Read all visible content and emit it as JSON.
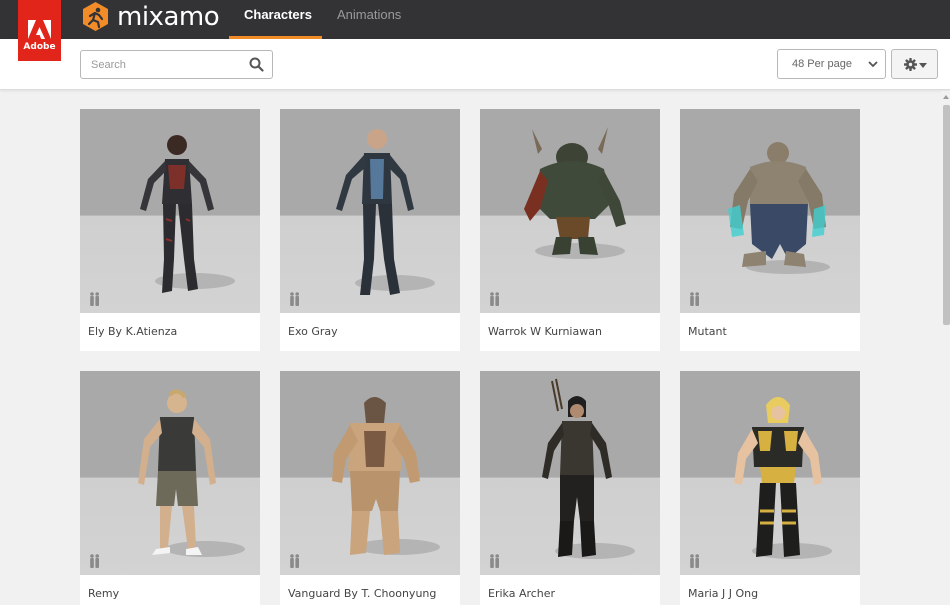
{
  "nav": {
    "adobe_label": "Adobe",
    "brand": "mixamo",
    "tabs": [
      {
        "label": "Characters",
        "active": true
      },
      {
        "label": "Animations",
        "active": false
      }
    ],
    "accent_color": "#f28c28",
    "adobe_color": "#e1251b"
  },
  "toolbar": {
    "search_placeholder": "Search",
    "per_page": "48 Per page",
    "search_icon": "search-icon",
    "settings_icon": "gear-icon"
  },
  "characters": [
    {
      "name": "Ely By K.Atienza"
    },
    {
      "name": "Exo Gray"
    },
    {
      "name": "Warrok W Kurniawan"
    },
    {
      "name": "Mutant"
    },
    {
      "name": "Remy"
    },
    {
      "name": "Vanguard By T. Choonyung"
    },
    {
      "name": "Erika Archer"
    },
    {
      "name": "Maria J J Ong"
    }
  ]
}
